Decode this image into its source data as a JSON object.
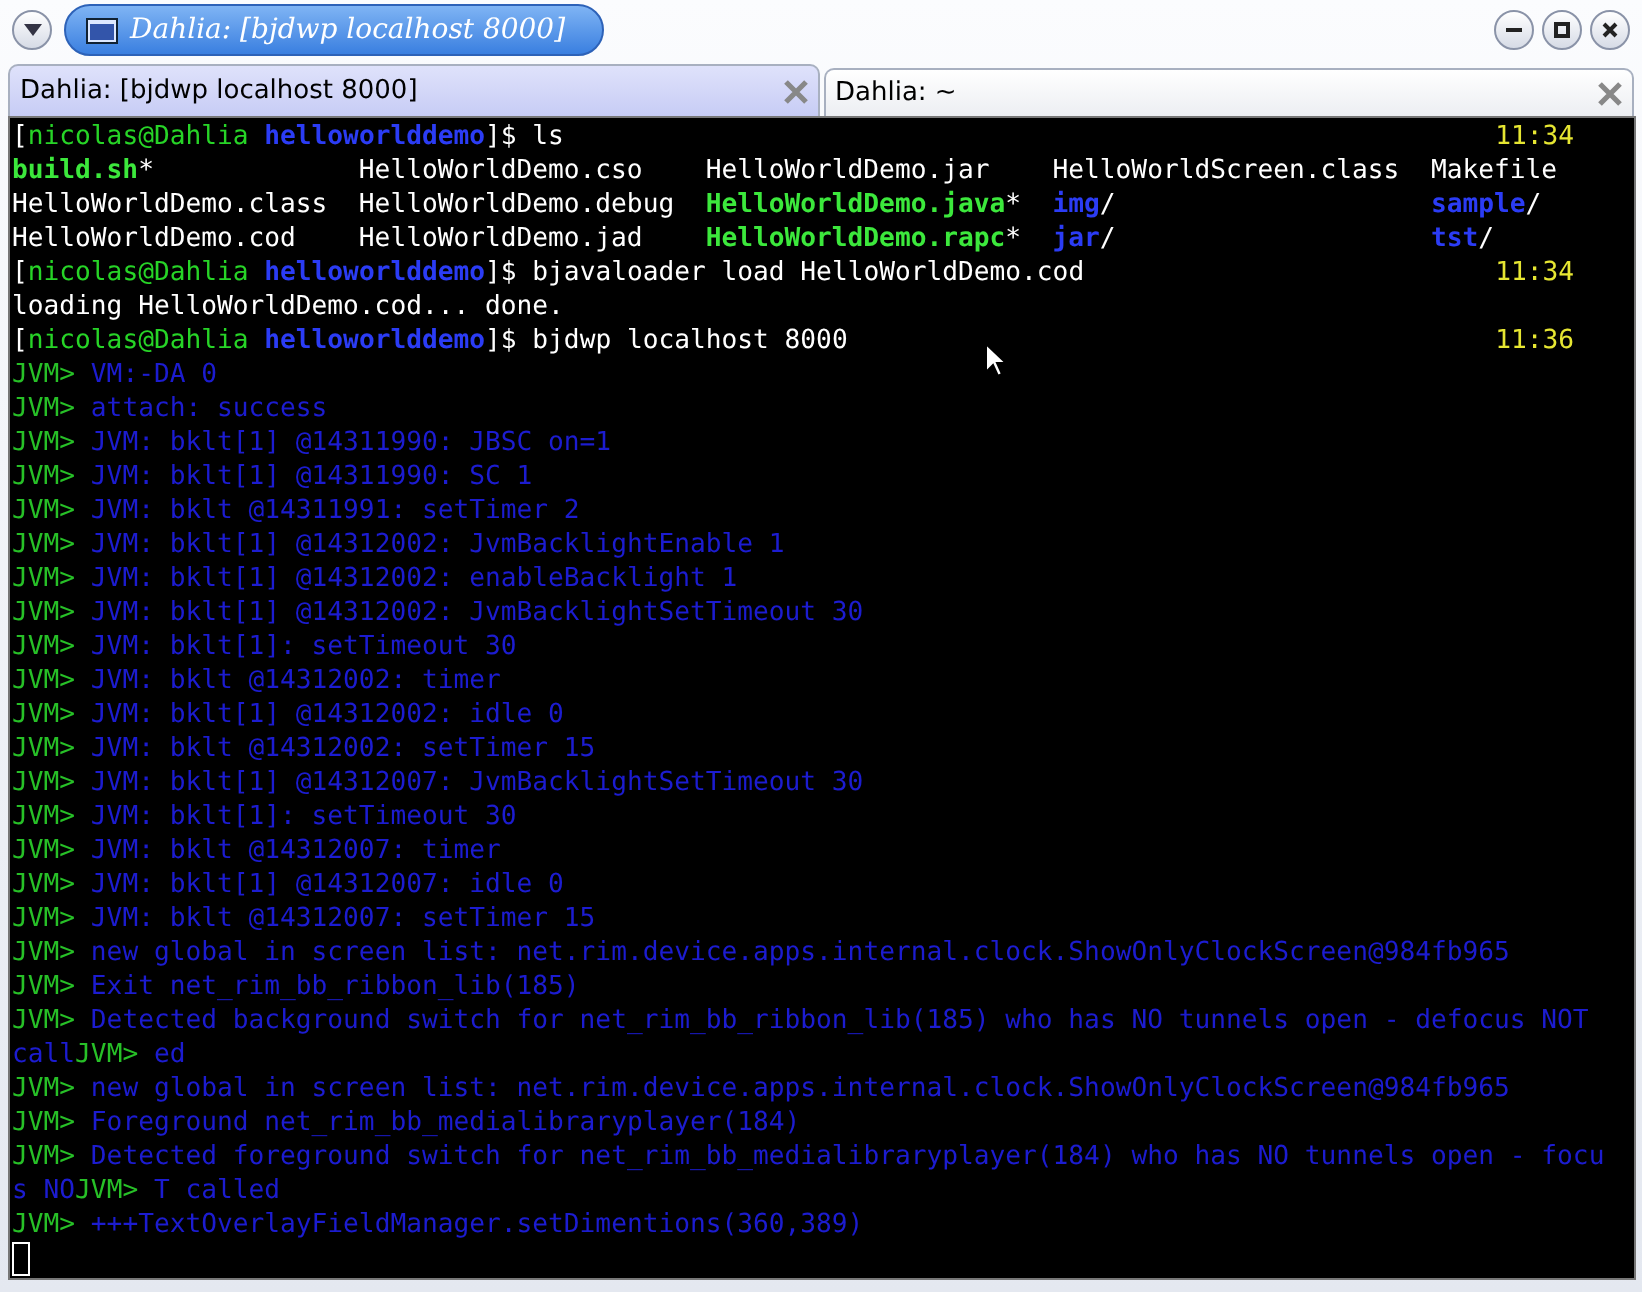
{
  "window": {
    "title": "Dahlia: [bjdwp localhost 8000]"
  },
  "tabs": [
    {
      "label": "Dahlia: [bjdwp localhost 8000]",
      "selected": true
    },
    {
      "label": "Dahlia: ~",
      "selected": false
    }
  ],
  "terminal": {
    "lines": [
      {
        "kind": "text",
        "segments": [
          {
            "text": "[",
            "kind": "plain"
          },
          {
            "text": "nicolas@Dahlia ",
            "kind": "user"
          },
          {
            "text": "helloworlddemo",
            "kind": "dir"
          },
          {
            "text": "]$ ls",
            "kind": "plain"
          }
        ],
        "time": "11:34"
      },
      {
        "kind": "columns",
        "cells": [
          [
            {
              "text": "build.sh",
              "kind": "exec"
            },
            {
              "text": "*",
              "kind": "plain"
            }
          ],
          [
            {
              "text": "HelloWorldDemo.cso",
              "kind": "plain"
            }
          ],
          [
            {
              "text": "HelloWorldDemo.jar",
              "kind": "plain"
            }
          ],
          [
            {
              "text": "HelloWorldScreen.class",
              "kind": "plain"
            }
          ],
          [
            {
              "text": "Makefile",
              "kind": "plain"
            }
          ]
        ]
      },
      {
        "kind": "columns",
        "cells": [
          [
            {
              "text": "HelloWorldDemo.class",
              "kind": "plain"
            }
          ],
          [
            {
              "text": "HelloWorldDemo.debug",
              "kind": "plain"
            }
          ],
          [
            {
              "text": "HelloWorldDemo.java",
              "kind": "exec"
            },
            {
              "text": "*",
              "kind": "plain"
            }
          ],
          [
            {
              "text": "img",
              "kind": "dir"
            },
            {
              "text": "/",
              "kind": "plain"
            }
          ],
          [
            {
              "text": "sample",
              "kind": "dir"
            },
            {
              "text": "/",
              "kind": "plain"
            }
          ]
        ]
      },
      {
        "kind": "columns",
        "cells": [
          [
            {
              "text": "HelloWorldDemo.cod",
              "kind": "plain"
            }
          ],
          [
            {
              "text": "HelloWorldDemo.jad",
              "kind": "plain"
            }
          ],
          [
            {
              "text": "HelloWorldDemo.rapc",
              "kind": "exec"
            },
            {
              "text": "*",
              "kind": "plain"
            }
          ],
          [
            {
              "text": "jar",
              "kind": "dir"
            },
            {
              "text": "/",
              "kind": "plain"
            }
          ],
          [
            {
              "text": "tst",
              "kind": "dir"
            },
            {
              "text": "/",
              "kind": "plain"
            }
          ]
        ]
      },
      {
        "kind": "text",
        "segments": [
          {
            "text": "[",
            "kind": "plain"
          },
          {
            "text": "nicolas@Dahlia ",
            "kind": "user"
          },
          {
            "text": "helloworlddemo",
            "kind": "dir"
          },
          {
            "text": "]$ bjavaloader load HelloWorldDemo.cod",
            "kind": "plain"
          }
        ],
        "time": "11:34"
      },
      {
        "kind": "text",
        "segments": [
          {
            "text": "loading HelloWorldDemo.cod... done.",
            "kind": "plain"
          }
        ]
      },
      {
        "kind": "text",
        "segments": [
          {
            "text": "[",
            "kind": "plain"
          },
          {
            "text": "nicolas@Dahlia ",
            "kind": "user"
          },
          {
            "text": "helloworlddemo",
            "kind": "dir"
          },
          {
            "text": "]$ bjdwp localhost 8000",
            "kind": "plain"
          }
        ],
        "time": "11:36"
      },
      {
        "kind": "text",
        "segments": [
          {
            "text": "JVM> ",
            "kind": "jvm"
          },
          {
            "text": "VM:-DA 0",
            "kind": "log"
          }
        ]
      },
      {
        "kind": "text",
        "segments": [
          {
            "text": "JVM> ",
            "kind": "jvm"
          },
          {
            "text": "attach: success",
            "kind": "log"
          }
        ]
      },
      {
        "kind": "text",
        "segments": [
          {
            "text": "JVM> ",
            "kind": "jvm"
          },
          {
            "text": "JVM: bklt[1] @14311990: JBSC on=1",
            "kind": "log"
          }
        ]
      },
      {
        "kind": "text",
        "segments": [
          {
            "text": "JVM> ",
            "kind": "jvm"
          },
          {
            "text": "JVM: bklt[1] @14311990: SC 1",
            "kind": "log"
          }
        ]
      },
      {
        "kind": "text",
        "segments": [
          {
            "text": "JVM> ",
            "kind": "jvm"
          },
          {
            "text": "JVM: bklt @14311991: setTimer 2",
            "kind": "log"
          }
        ]
      },
      {
        "kind": "text",
        "segments": [
          {
            "text": "JVM> ",
            "kind": "jvm"
          },
          {
            "text": "JVM: bklt[1] @14312002: JvmBacklightEnable 1",
            "kind": "log"
          }
        ]
      },
      {
        "kind": "text",
        "segments": [
          {
            "text": "JVM> ",
            "kind": "jvm"
          },
          {
            "text": "JVM: bklt[1] @14312002: enableBacklight 1",
            "kind": "log"
          }
        ]
      },
      {
        "kind": "text",
        "segments": [
          {
            "text": "JVM> ",
            "kind": "jvm"
          },
          {
            "text": "JVM: bklt[1] @14312002: JvmBacklightSetTimeout 30",
            "kind": "log"
          }
        ]
      },
      {
        "kind": "text",
        "segments": [
          {
            "text": "JVM> ",
            "kind": "jvm"
          },
          {
            "text": "JVM: bklt[1]: setTimeout 30",
            "kind": "log"
          }
        ]
      },
      {
        "kind": "text",
        "segments": [
          {
            "text": "JVM> ",
            "kind": "jvm"
          },
          {
            "text": "JVM: bklt @14312002: timer",
            "kind": "log"
          }
        ]
      },
      {
        "kind": "text",
        "segments": [
          {
            "text": "JVM> ",
            "kind": "jvm"
          },
          {
            "text": "JVM: bklt[1] @14312002: idle 0",
            "kind": "log"
          }
        ]
      },
      {
        "kind": "text",
        "segments": [
          {
            "text": "JVM> ",
            "kind": "jvm"
          },
          {
            "text": "JVM: bklt @14312002: setTimer 15",
            "kind": "log"
          }
        ]
      },
      {
        "kind": "text",
        "segments": [
          {
            "text": "JVM> ",
            "kind": "jvm"
          },
          {
            "text": "JVM: bklt[1] @14312007: JvmBacklightSetTimeout 30",
            "kind": "log"
          }
        ]
      },
      {
        "kind": "text",
        "segments": [
          {
            "text": "JVM> ",
            "kind": "jvm"
          },
          {
            "text": "JVM: bklt[1]: setTimeout 30",
            "kind": "log"
          }
        ]
      },
      {
        "kind": "text",
        "segments": [
          {
            "text": "JVM> ",
            "kind": "jvm"
          },
          {
            "text": "JVM: bklt @14312007: timer",
            "kind": "log"
          }
        ]
      },
      {
        "kind": "text",
        "segments": [
          {
            "text": "JVM> ",
            "kind": "jvm"
          },
          {
            "text": "JVM: bklt[1] @14312007: idle 0",
            "kind": "log"
          }
        ]
      },
      {
        "kind": "text",
        "segments": [
          {
            "text": "JVM> ",
            "kind": "jvm"
          },
          {
            "text": "JVM: bklt @14312007: setTimer 15",
            "kind": "log"
          }
        ]
      },
      {
        "kind": "text",
        "segments": [
          {
            "text": "JVM> ",
            "kind": "jvm"
          },
          {
            "text": "new global in screen list: net.rim.device.apps.internal.clock.ShowOnlyClockScreen@984fb965",
            "kind": "log"
          }
        ]
      },
      {
        "kind": "text",
        "segments": [
          {
            "text": "JVM> ",
            "kind": "jvm"
          },
          {
            "text": "Exit net_rim_bb_ribbon_lib(185)",
            "kind": "log"
          }
        ]
      },
      {
        "kind": "text",
        "segments": [
          {
            "text": "JVM> ",
            "kind": "jvm"
          },
          {
            "text": "Detected background switch for net_rim_bb_ribbon_lib(185) who has NO tunnels open - defocus NOT",
            "kind": "log"
          }
        ]
      },
      {
        "kind": "text",
        "segments": [
          {
            "text": "call",
            "kind": "log"
          },
          {
            "text": "JVM> ",
            "kind": "jvm"
          },
          {
            "text": "ed",
            "kind": "log"
          }
        ]
      },
      {
        "kind": "text",
        "segments": [
          {
            "text": "JVM> ",
            "kind": "jvm"
          },
          {
            "text": "new global in screen list: net.rim.device.apps.internal.clock.ShowOnlyClockScreen@984fb965",
            "kind": "log"
          }
        ]
      },
      {
        "kind": "text",
        "segments": [
          {
            "text": "JVM> ",
            "kind": "jvm"
          },
          {
            "text": "Foreground net_rim_bb_medialibraryplayer(184)",
            "kind": "log"
          }
        ]
      },
      {
        "kind": "text",
        "segments": [
          {
            "text": "JVM> ",
            "kind": "jvm"
          },
          {
            "text": "Detected foreground switch for net_rim_bb_medialibraryplayer(184) who has NO tunnels open - focu",
            "kind": "log"
          }
        ]
      },
      {
        "kind": "text",
        "segments": [
          {
            "text": "s NO",
            "kind": "log"
          },
          {
            "text": "JVM> ",
            "kind": "jvm"
          },
          {
            "text": "T called",
            "kind": "log"
          }
        ]
      },
      {
        "kind": "text",
        "segments": [
          {
            "text": "JVM> ",
            "kind": "jvm"
          },
          {
            "text": "+++TextOverlayFieldManager.setDimentions(360,389)",
            "kind": "log"
          }
        ]
      }
    ]
  }
}
